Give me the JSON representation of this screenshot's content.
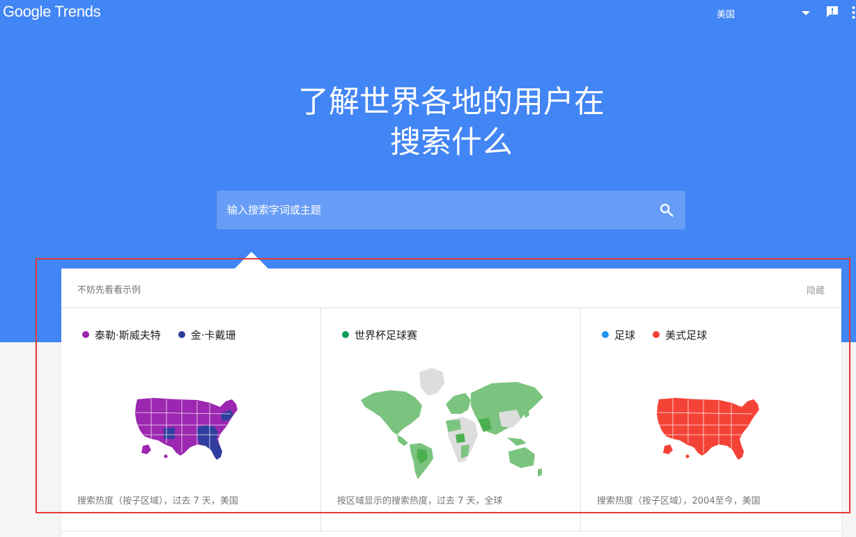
{
  "header": {
    "logo": "Google Trends",
    "region": "美国"
  },
  "hero": {
    "title_line1": "了解世界各地的用户在",
    "title_line2": "搜索什么"
  },
  "search": {
    "placeholder": "输入搜索字词或主题"
  },
  "examples": {
    "title": "不妨先看看示例",
    "hide_label": "隐藏",
    "cards": [
      {
        "legend": [
          {
            "label": "泰勒·斯威夫特",
            "color": "#9c27b0"
          },
          {
            "label": "金·卡戴珊",
            "color": "#303f9f"
          }
        ],
        "caption": "搜索热度（按子区域），过去 7 天，美国"
      },
      {
        "legend": [
          {
            "label": "世界杯足球赛",
            "color": "#0f9d58"
          }
        ],
        "caption": "按区域显示的搜索热度，过去 7 天，全球"
      },
      {
        "legend": [
          {
            "label": "足球",
            "color": "#2196f3"
          },
          {
            "label": "美式足球",
            "color": "#f44336"
          }
        ],
        "caption": "搜索热度（按子区域），2004至今，美国"
      }
    ]
  },
  "colors": {
    "brand_blue": "#4285f4",
    "highlight_red": "#e53935",
    "map_green": "#7bc47f",
    "map_grey": "#dddddd"
  }
}
